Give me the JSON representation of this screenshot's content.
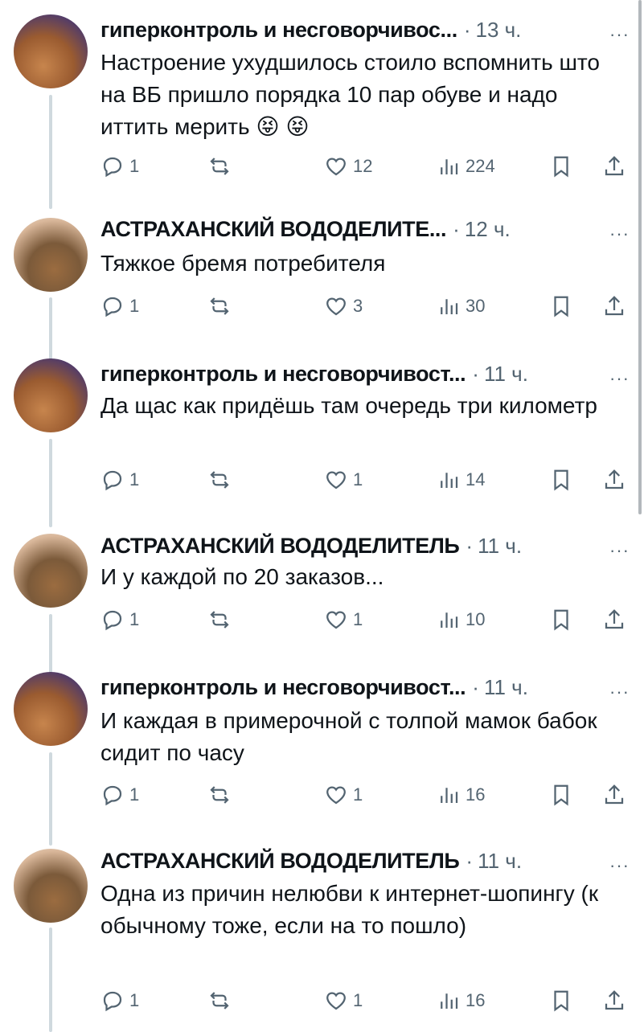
{
  "tweets": [
    {
      "author": "гиперконтроль и несговорчивос...",
      "time": "13 ч.",
      "text": "Настроение ухудшилось стоило вспомнить што на ВБ пришло порядка 10 пар обуве и надо иттить мерить 😝 😝",
      "replies": "1",
      "likes": "12",
      "views": "224",
      "avatar": "cat-with-sunglasses"
    },
    {
      "author": "АСТРАХАНСКИЙ ВОДОДЕЛИТЕ...",
      "time": "12 ч.",
      "text": "Тяжкое бремя потребителя",
      "replies": "1",
      "likes": "3",
      "views": "30",
      "avatar": "hand-petting-cat"
    },
    {
      "author": "гиперконтроль и несговорчивост...",
      "time": "11 ч.",
      "text": "Да щас как придёшь там очередь три километр",
      "replies": "1",
      "likes": "1",
      "views": "14",
      "avatar": "cat-with-sunglasses"
    },
    {
      "author": "АСТРАХАНСКИЙ ВОДОДЕЛИТЕЛЬ",
      "time": "11 ч.",
      "text": "И у каждой по 20 заказов...",
      "replies": "1",
      "likes": "1",
      "views": "10",
      "avatar": "hand-petting-cat"
    },
    {
      "author": "гиперконтроль и несговорчивост...",
      "time": "11 ч.",
      "text": "И каждая в примерочной с толпой мамок бабок сидит по часу",
      "replies": "1",
      "likes": "1",
      "views": "16",
      "avatar": "cat-with-sunglasses"
    },
    {
      "author": "АСТРАХАНСКИЙ ВОДОДЕЛИТЕЛЬ",
      "time": "11 ч.",
      "text": "Одна из причин нелюбви к интернет-шопингу (к обычному тоже, если на то пошло)",
      "replies": "1",
      "likes": "1",
      "views": "16",
      "avatar": "hand-petting-cat"
    }
  ],
  "ui": {
    "separator": "·",
    "more": "···"
  },
  "colors": {
    "text": "#0f1419",
    "secondary": "#536471",
    "thread_line": "#cfd9de",
    "background": "#ffffff"
  }
}
